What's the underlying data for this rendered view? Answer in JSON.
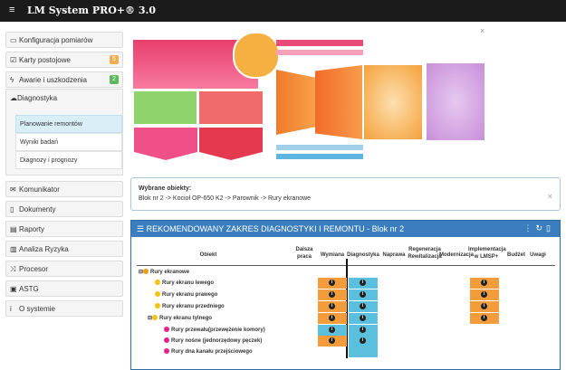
{
  "app": {
    "menu_icon": "hamburger-icon",
    "title": "LM System PRO+® 3.0"
  },
  "sidebar": {
    "items": [
      {
        "icon": "gauge-icon",
        "label": "Konfiguracja pomiarów"
      },
      {
        "icon": "check-square-icon",
        "label": "Karty postojowe",
        "badge": "5",
        "badge_color": "#f0ad4e"
      },
      {
        "icon": "bolt-icon",
        "label": "Awarie i uszkodzenia",
        "badge": "2",
        "badge_color": "#5cb85c"
      },
      {
        "icon": "cloud-icon",
        "label": "Diagnostyka"
      }
    ],
    "diagnostyka_sub": [
      "Planowanie remontów",
      "Wyniki badań",
      "Diagnozy i prognozy"
    ],
    "items_after": [
      {
        "icon": "envelope-icon",
        "label": "Komunikator"
      },
      {
        "icon": "document-icon",
        "label": "Dokumenty"
      },
      {
        "icon": "report-icon",
        "label": "Raporty"
      },
      {
        "icon": "chart-icon",
        "label": "Analiza Ryzyka"
      },
      {
        "icon": "shuffle-icon",
        "label": "Procesor"
      },
      {
        "icon": "monitor-icon",
        "label": "ASTG"
      },
      {
        "icon": "info-icon",
        "label": "O systemie"
      }
    ]
  },
  "selected": {
    "label": "Wybrane obiekty:",
    "path": "Blok nr 2 -> Kocioł OP-650 K2 -> Parownik -> Rury ekranowe"
  },
  "panel": {
    "title": "REKOMENDOWANY ZAKRES DIAGNOSTYKI I REMONTU - Blok nr 2",
    "columns": [
      "Obiekt",
      "Dalsza praca",
      "Wymiana",
      "Diagnostyka",
      "Naprawa",
      "Regeneracja Rewitalizacja",
      "Modernizacja",
      "Implementacja w LMSP+",
      "Budżet",
      "Uwagi"
    ],
    "rows": [
      {
        "label": "Rury ekranowe",
        "indent": 0,
        "toggle": "⊟",
        "dot": "#f39c12"
      },
      {
        "label": "Rury ekranu lewego",
        "indent": 1,
        "dot": "#f1c40f"
      },
      {
        "label": "Rury ekranu prawego",
        "indent": 1,
        "dot": "#f1c40f"
      },
      {
        "label": "Rury ekranu przedniego",
        "indent": 1,
        "dot": "#f1c40f"
      },
      {
        "label": "Rury ekranu tylnego",
        "indent": 1,
        "toggle": "⊟",
        "dot": "#f1c40f"
      },
      {
        "label": "Rury przewału(przewężenie komory)",
        "indent": 2,
        "dot": "#e91e8c"
      },
      {
        "label": "Rury nośne (jednorzędowy pęczek)",
        "indent": 2,
        "dot": "#e91e8c"
      },
      {
        "label": "Rury dna kanału przejściowego",
        "indent": 2,
        "dot": "#e91e8c"
      }
    ]
  }
}
